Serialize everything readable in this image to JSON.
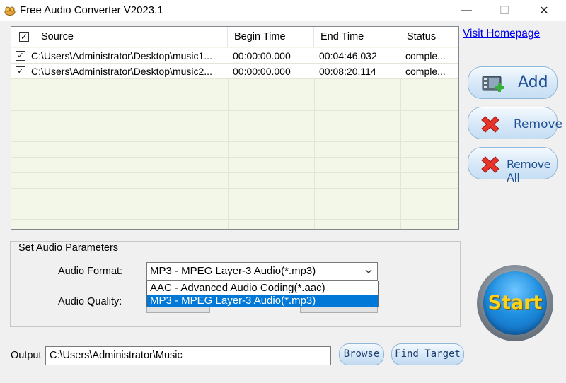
{
  "window": {
    "title": "Free Audio Converter V2023.1",
    "controls": {
      "minimize": "—",
      "maximize": "☐",
      "close": "✕"
    }
  },
  "file_list": {
    "columns": [
      "Source",
      "Begin Time",
      "End Time",
      "Status"
    ],
    "header_checked": true,
    "rows": [
      {
        "checked": true,
        "source": "C:\\Users\\Administrator\\Desktop\\music1...",
        "begin": "00:00:00.000",
        "end": "00:04:46.032",
        "status": "comple..."
      },
      {
        "checked": true,
        "source": "C:\\Users\\Administrator\\Desktop\\music2...",
        "begin": "00:00:00.000",
        "end": "00:08:20.114",
        "status": "comple..."
      }
    ]
  },
  "sidebar": {
    "visit_link": "Visit Homepage",
    "add_label": "Add",
    "remove_label": "Remove",
    "remove_all_label": "Remove All"
  },
  "params": {
    "group_title": "Set Audio Parameters",
    "format_label": "Audio Format:",
    "quality_label": "Audio Quality:",
    "format_value": "MP3 - MPEG Layer-3 Audio(*.mp3)",
    "format_options": [
      "AAC - Advanced Audio Coding(*.aac)",
      "MP3 - MPEG Layer-3 Audio(*.mp3)"
    ]
  },
  "start": {
    "label": "Start"
  },
  "output": {
    "label": "Output",
    "path": "C:\\Users\\Administrator\\Music",
    "browse_label": "Browse",
    "find_target_label": "Find Target"
  },
  "colors": {
    "list_bg": "#f3f7e8",
    "selection": "#0078d7",
    "start_text": "#ffd21a",
    "button_text": "#1f4f94"
  }
}
